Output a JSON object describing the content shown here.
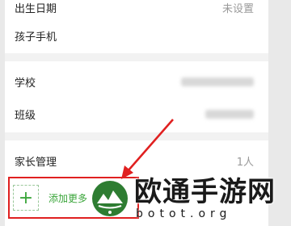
{
  "profile": {
    "birthday": {
      "label": "出生日期",
      "value": "未设置"
    },
    "child_phone": {
      "label": "孩子手机",
      "value": ""
    },
    "school": {
      "label": "学校"
    },
    "class": {
      "label": "班级"
    },
    "parents": {
      "label": "家长管理",
      "value": "1人"
    },
    "add_more": {
      "label": "添加更多",
      "icon": "plus-icon"
    }
  },
  "watermark": {
    "title": "欧通手游网",
    "domain": "botot.org"
  },
  "colors": {
    "accent_green": "#3aa53a",
    "highlight_red": "#e02020"
  }
}
